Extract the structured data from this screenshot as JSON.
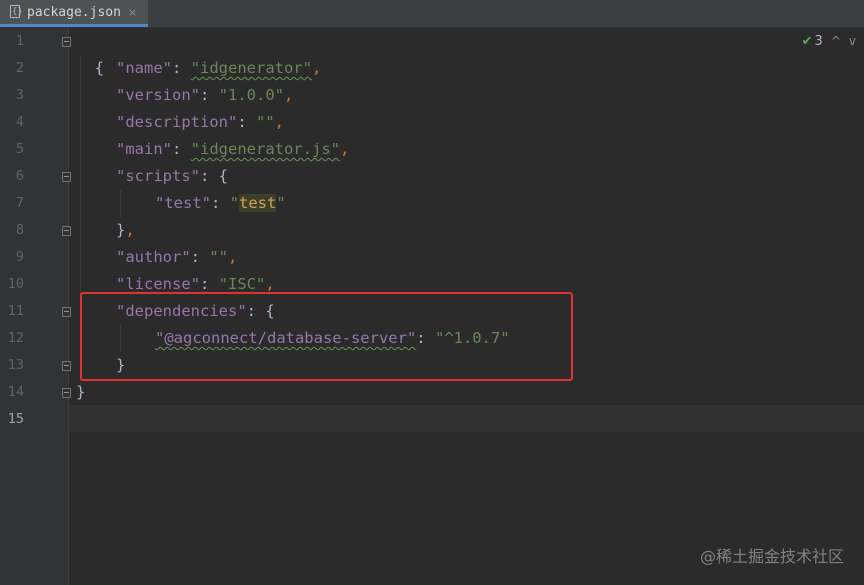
{
  "tab": {
    "filename": "package.json",
    "close_glyph": "×",
    "icon": "json-file-icon"
  },
  "inspection": {
    "check_glyph": "✔",
    "count": "3",
    "up_glyph": "^",
    "down_glyph": "v"
  },
  "gutter": {
    "line_numbers": [
      "1",
      "2",
      "3",
      "4",
      "5",
      "6",
      "7",
      "8",
      "9",
      "10",
      "11",
      "12",
      "13",
      "14",
      "15"
    ]
  },
  "code": {
    "l1": {
      "brace": "{"
    },
    "l2": {
      "key": "\"name\"",
      "colon": ": ",
      "value": "\"idgenerator\"",
      "comma": ","
    },
    "l3": {
      "key": "\"version\"",
      "colon": ": ",
      "value": "\"1.0.0\"",
      "comma": ","
    },
    "l4": {
      "key": "\"description\"",
      "colon": ": ",
      "value": "\"\"",
      "comma": ","
    },
    "l5": {
      "key": "\"main\"",
      "colon": ": ",
      "value": "\"idgenerator.js\"",
      "comma": ","
    },
    "l6": {
      "key": "\"scripts\"",
      "colon": ": ",
      "brace": "{"
    },
    "l7": {
      "key": "\"test\"",
      "colon": ": ",
      "value_q1": "\"",
      "value_mid": "test",
      "value_q2": "\""
    },
    "l8": {
      "brace": "}",
      "comma": ","
    },
    "l9": {
      "key": "\"author\"",
      "colon": ": ",
      "value": "\"\"",
      "comma": ","
    },
    "l10": {
      "key": "\"license\"",
      "colon": ": ",
      "value": "\"ISC\"",
      "comma": ","
    },
    "l11": {
      "key": "\"dependencies\"",
      "colon": ": ",
      "brace": "{"
    },
    "l12": {
      "key": "\"@agconnect/database-server\"",
      "colon": ": ",
      "value": "\"^1.0.7\""
    },
    "l13": {
      "brace": "}"
    },
    "l14": {
      "brace": "}"
    },
    "l15": {
      "text": ""
    }
  },
  "watermark": "@稀土掘金技术社区",
  "colors": {
    "background": "#2b2b2b",
    "key": "#9876aa",
    "string": "#6a8759",
    "punctuation": "#cc7832",
    "highlight_box": "#e0322e"
  }
}
